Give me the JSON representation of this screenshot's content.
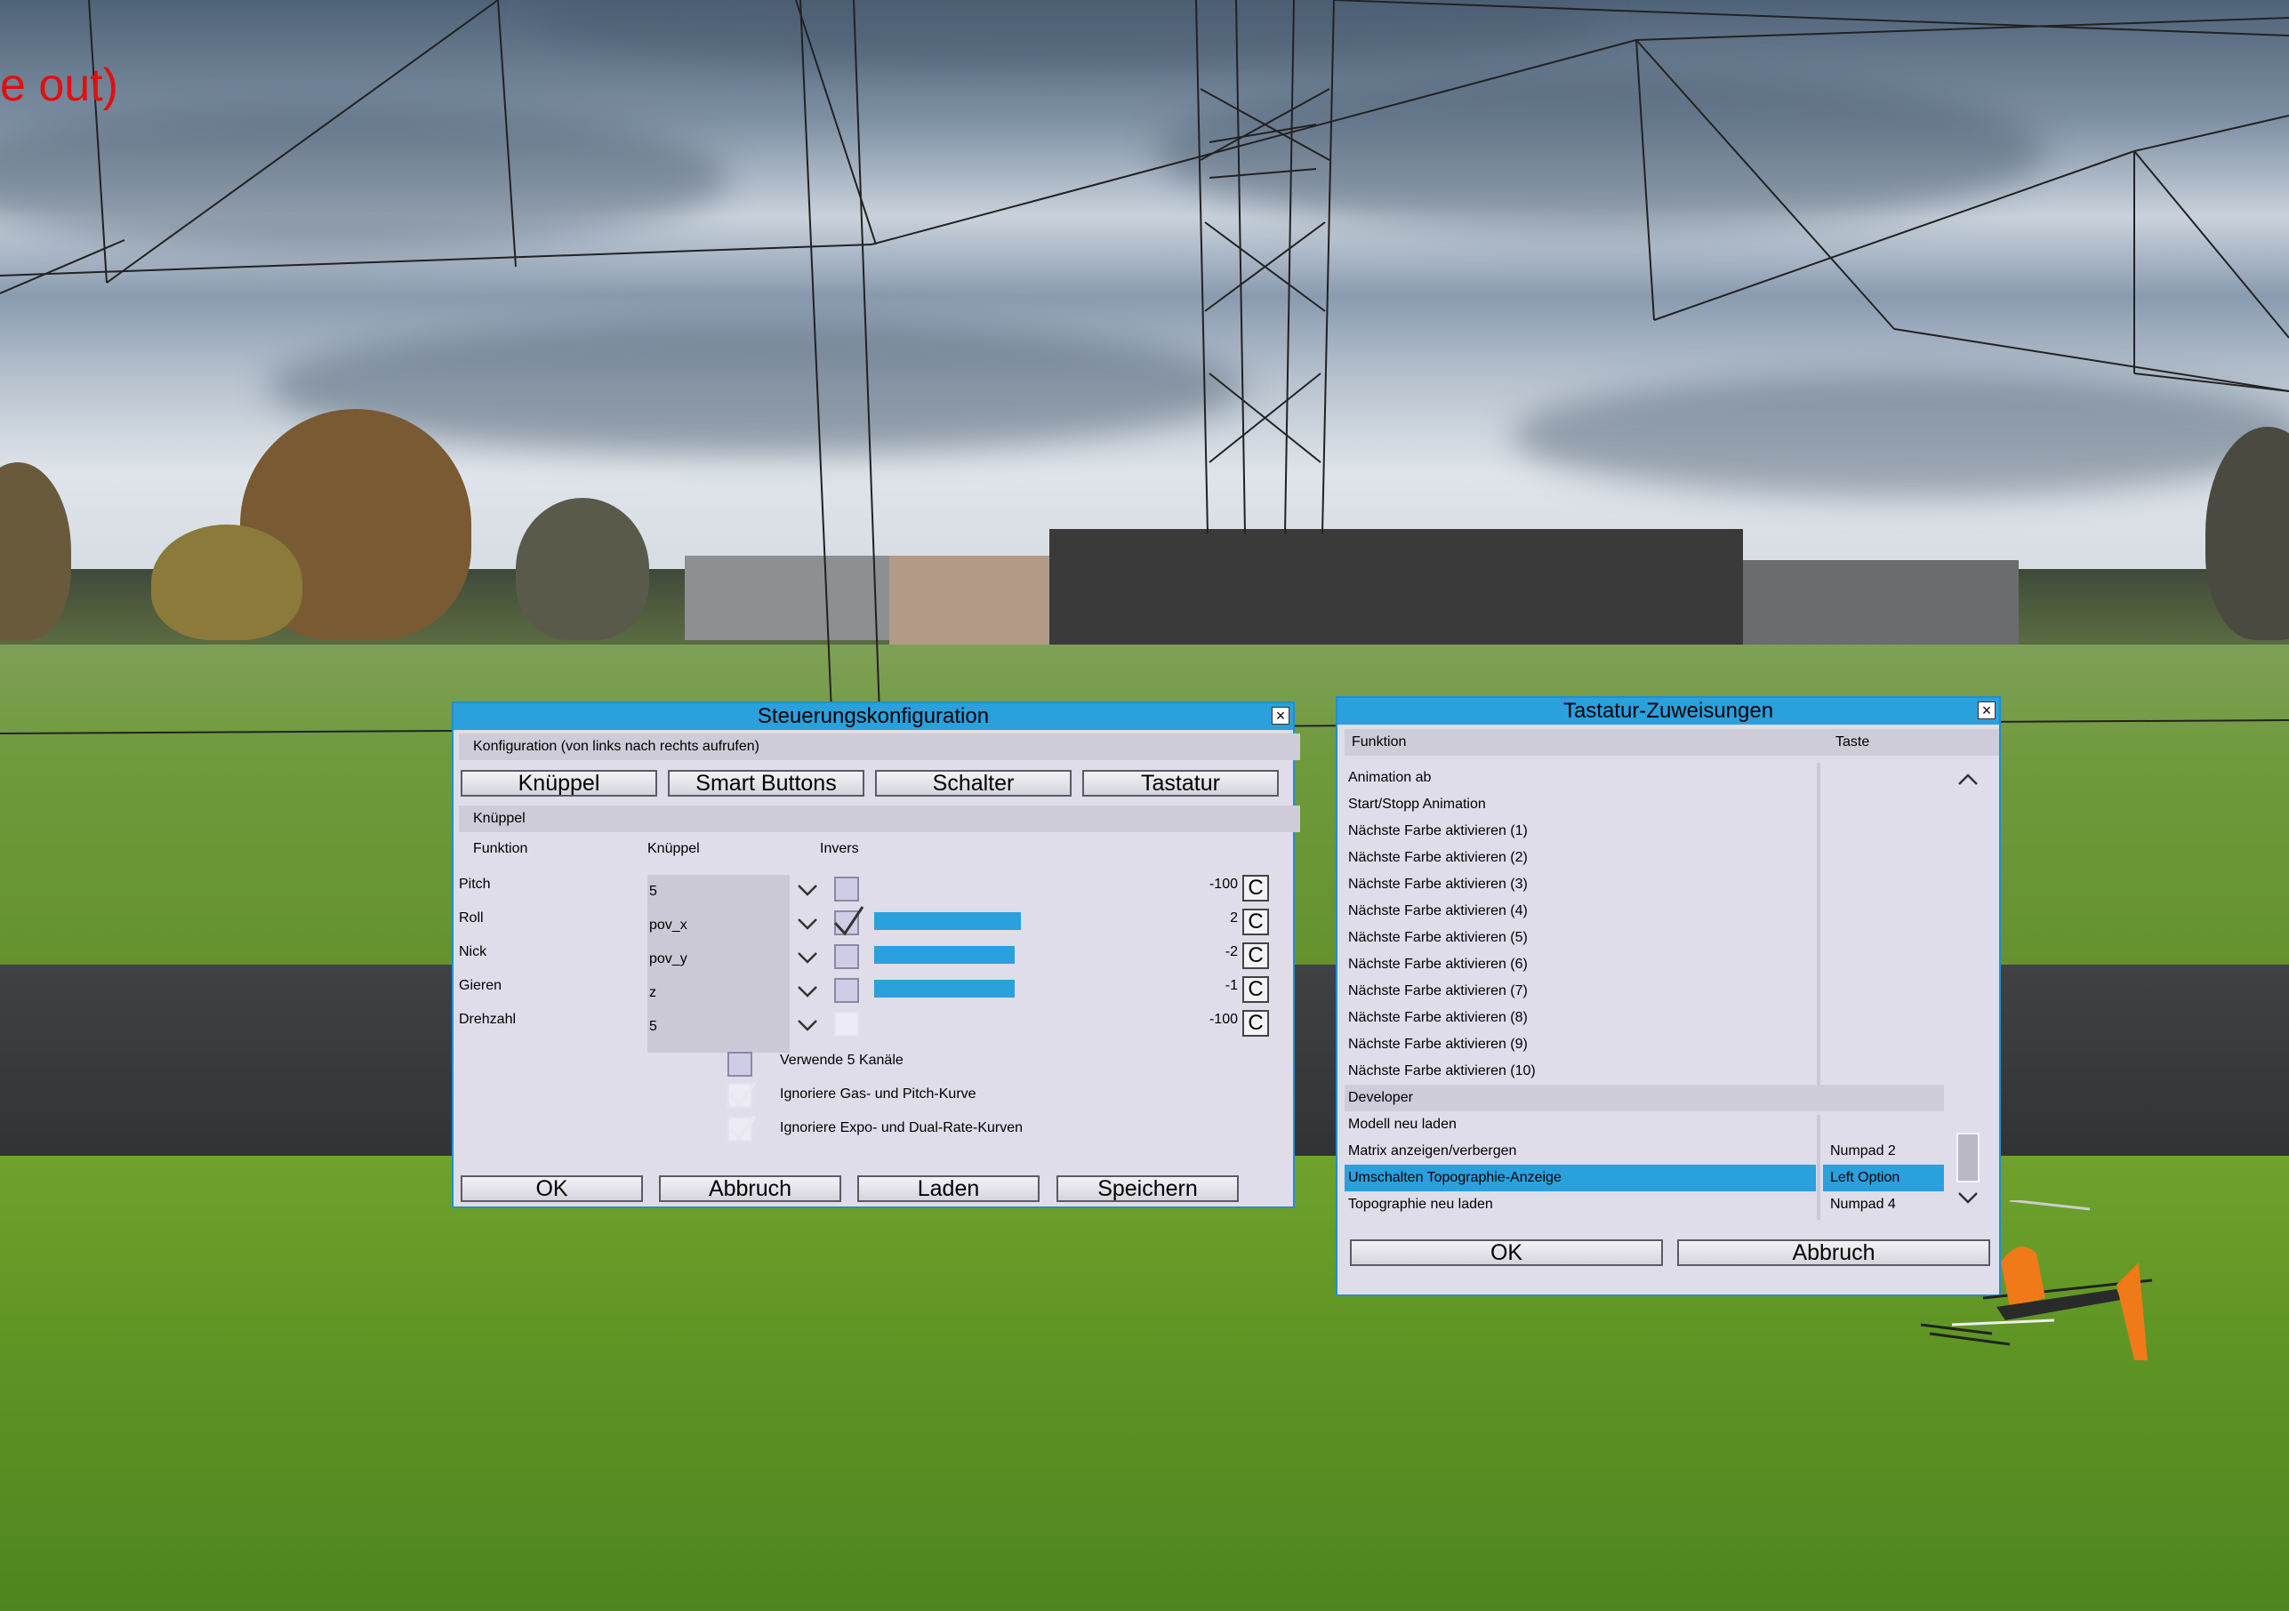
{
  "overlay": {
    "text": "e out)"
  },
  "steuerung": {
    "title": "Steuerungskonfiguration",
    "close_glyph": "×",
    "config_label": "Konfiguration (von links nach rechts aufrufen)",
    "tabs": [
      "Knüppel",
      "Smart Buttons",
      "Schalter",
      "Tastatur"
    ],
    "section": "Knüppel",
    "headers": {
      "function": "Funktion",
      "stick": "Knüppel",
      "invert": "Invers"
    },
    "rows": [
      {
        "name": "Pitch",
        "stick": "5",
        "inverted": false,
        "bar": 0,
        "value": "-100",
        "c": "C"
      },
      {
        "name": "Roll",
        "stick": "pov_x",
        "inverted": true,
        "bar": 0.94,
        "value": "2",
        "c": "C"
      },
      {
        "name": "Nick",
        "stick": "pov_y",
        "inverted": false,
        "bar": 0.9,
        "value": "-2",
        "c": "C"
      },
      {
        "name": "Gieren",
        "stick": "z",
        "inverted": false,
        "bar": 0.9,
        "value": "-1",
        "c": "C"
      },
      {
        "name": "Drehzahl",
        "stick": "5",
        "inverted": false,
        "bar": 0,
        "value": "-100",
        "c": "C"
      }
    ],
    "options": [
      {
        "label": "Verwende 5 Kanäle",
        "checked": false
      },
      {
        "label": "Ignoriere Gas- und Pitch-Kurve",
        "checked": true
      },
      {
        "label": "Ignoriere Expo- und Dual-Rate-Kurven",
        "checked": true
      }
    ],
    "buttons": {
      "ok": "OK",
      "cancel": "Abbruch",
      "load": "Laden",
      "save": "Speichern"
    }
  },
  "tastatur": {
    "title": "Tastatur-Zuweisungen",
    "close_glyph": "×",
    "headers": {
      "function": "Funktion",
      "key": "Taste"
    },
    "items": [
      {
        "label": "Animation ab",
        "key": ""
      },
      {
        "label": "Start/Stopp Animation",
        "key": ""
      },
      {
        "label": "Nächste Farbe aktivieren (1)",
        "key": ""
      },
      {
        "label": "Nächste Farbe aktivieren (2)",
        "key": ""
      },
      {
        "label": "Nächste Farbe aktivieren (3)",
        "key": ""
      },
      {
        "label": "Nächste Farbe aktivieren (4)",
        "key": ""
      },
      {
        "label": "Nächste Farbe aktivieren (5)",
        "key": ""
      },
      {
        "label": "Nächste Farbe aktivieren (6)",
        "key": ""
      },
      {
        "label": "Nächste Farbe aktivieren (7)",
        "key": ""
      },
      {
        "label": "Nächste Farbe aktivieren (8)",
        "key": ""
      },
      {
        "label": "Nächste Farbe aktivieren (9)",
        "key": ""
      },
      {
        "label": "Nächste Farbe aktivieren (10)",
        "key": ""
      }
    ],
    "group": "Developer",
    "dev_items": [
      {
        "label": "Modell neu laden",
        "key": "",
        "selected": false
      },
      {
        "label": "Matrix anzeigen/verbergen",
        "key": "Numpad 2",
        "selected": false
      },
      {
        "label": "Umschalten Topographie-Anzeige",
        "key": "Left Option",
        "selected": true
      },
      {
        "label": "Topographie neu laden",
        "key": "Numpad 4",
        "selected": false
      }
    ],
    "buttons": {
      "ok": "OK",
      "cancel": "Abbruch"
    }
  },
  "colors": {
    "accent": "#2aa0dc",
    "dialog_bg": "#dedde9",
    "overlay_text": "#e01010"
  }
}
